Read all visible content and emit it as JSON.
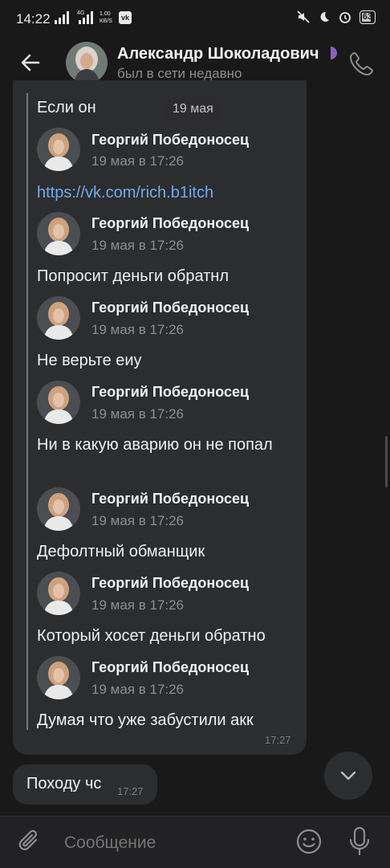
{
  "status_bar": {
    "time": "14:22",
    "network_1": "4G",
    "speed_value": "1.00",
    "speed_unit": "KB/S",
    "app_badge": "vk-icon",
    "battery": "63"
  },
  "header": {
    "name": "Александр Шоколадович",
    "status": "был в сети недавно",
    "icons": [
      "back-arrow-icon",
      "phone-icon"
    ]
  },
  "date_chip": "19 мая",
  "forwarded": {
    "first_text": "Если он",
    "entries": [
      {
        "sender": "Георгий Победоносец",
        "time": "19 мая в 17:26",
        "text": "https://vk.com/rich.b1itch",
        "is_link": true
      },
      {
        "sender": "Георгий Победоносец",
        "time": "19 мая в 17:26",
        "text": "Попросит деньги обратнл"
      },
      {
        "sender": "Георгий Победоносец",
        "time": "19 мая в 17:26",
        "text": "Не верьте еиу"
      },
      {
        "sender": "Георгий Победоносец",
        "time": "19 мая в 17:26",
        "text": "Ни в какую аварию он не попал"
      },
      {
        "sender": "Георгий Победоносец",
        "time": "19 мая в 17:26",
        "text": "Дефолтный обманщик"
      },
      {
        "sender": "Георгий Победоносец",
        "time": "19 мая в 17:26",
        "text": "Который хосет деньги обратно"
      },
      {
        "sender": "Георгий Победоносец",
        "time": "19 мая в 17:26",
        "text": "Думая что уже забустили акк"
      }
    ],
    "bubble_time": "17:27"
  },
  "message2": {
    "text": "Походу чс",
    "time": "17:27"
  },
  "composer": {
    "placeholder": "Сообщение",
    "icons": [
      "attach-icon",
      "emoji-icon",
      "microphone-icon"
    ]
  },
  "colors": {
    "background": "#19191a",
    "bubble": "#2c2d2f",
    "link": "#71aaeb",
    "secondary_text": "#8c8e92"
  }
}
